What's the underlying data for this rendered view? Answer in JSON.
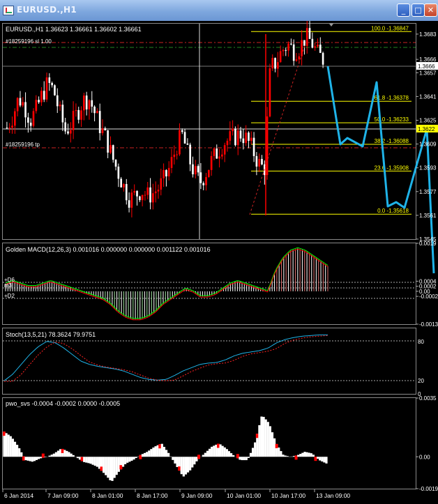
{
  "window": {
    "title": "EURUSD.,H1"
  },
  "colors": {
    "up": "#ff0000",
    "down": "#ffffff",
    "fib": "#ffff00",
    "projection": "#1fb3e8",
    "current_price": "#ffff00",
    "macd_green": "#00ff00",
    "macd_red": "#ff0000"
  },
  "chart_data": [
    {
      "type": "candlestick",
      "title": "EURUSD.,H1 1.36623 1.36661 1.36602 1.36661",
      "order_labels": [
        "#18259196 sl 1.00",
        "#18259196 tp"
      ],
      "current_price": "1.3666",
      "price_marker": "1.3622",
      "fib_levels": [
        {
          "label": "100.0 -1.36847",
          "value": 1.36847
        },
        {
          "label": "61.8 -1.36378",
          "value": 1.36378
        },
        {
          "label": "50.0 -1.36233",
          "value": 1.36233
        },
        {
          "label": "38.2 -1.36088",
          "value": 1.36088
        },
        {
          "label": "23.6 -1.35908",
          "value": 1.35908
        },
        {
          "label": "0.0 -1.35618",
          "value": 1.35618
        }
      ],
      "y_ticks": [
        "1.3683",
        "1.3666",
        "1.3657",
        "1.3641",
        "1.3625",
        "1.3609",
        "1.3593",
        "1.3577",
        "1.3561",
        "1.3545"
      ],
      "ylim": [
        1.3545,
        1.369
      ],
      "close_path": [
        1.362,
        1.3628,
        1.364,
        1.3635,
        1.3625,
        1.3632,
        1.3642,
        1.365,
        1.3645,
        1.363,
        1.3618,
        1.3622,
        1.363,
        1.3638,
        1.364,
        1.363,
        1.362,
        1.3612,
        1.36,
        1.359,
        1.358,
        1.3572,
        1.3575,
        1.3578,
        1.3574,
        1.3576,
        1.358,
        1.3586,
        1.3595,
        1.3608,
        1.3615,
        1.36,
        1.359,
        1.3583,
        1.359,
        1.3598,
        1.3604,
        1.361,
        1.3612,
        1.3614,
        1.3616,
        1.3612,
        1.3605,
        1.3596,
        1.3592,
        1.366,
        1.3664,
        1.3672,
        1.3676,
        1.3672,
        1.3674,
        1.3681,
        1.3678,
        1.367,
        1.3666
      ],
      "projection": [
        1.3666,
        1.362,
        1.3616,
        1.3656,
        1.3616,
        1.3579,
        1.3575,
        1.3622,
        1.3548
      ]
    },
    {
      "type": "histogram",
      "title": "Golden MACD(12,26,3) 0.001016 0.000000 0.000000 0.001122 0.001016",
      "level_labels": [
        "+D6",
        "m3",
        "+D2"
      ],
      "y_ticks": [
        "0.0019",
        "0.0004",
        "0.0002",
        "0.00",
        "-0.0002",
        "-0.0013"
      ],
      "ylim": [
        -0.0013,
        0.0019
      ],
      "values": [
        0.0003,
        0.0004,
        0.0003,
        0.0002,
        0.0002,
        0.0003,
        0.0004,
        0.0003,
        0.0002,
        0.0001,
        0.0,
        -0.0001,
        -0.0002,
        -0.0003,
        -0.0005,
        -0.0008,
        -0.001,
        -0.0011,
        -0.0011,
        -0.001,
        -0.0008,
        -0.0005,
        -0.0003,
        -0.0001,
        0.0001,
        0.0,
        -0.0002,
        -0.0002,
        -0.0001,
        0.0001,
        0.0003,
        0.0004,
        0.0003,
        0.0002,
        0.0001,
        0.0,
        0.0008,
        0.0013,
        0.0016,
        0.0017,
        0.0016,
        0.0014,
        0.0012,
        0.001
      ]
    },
    {
      "type": "line",
      "title": "Stoch(13,5,21) 78.3624 79.9751",
      "y_ticks": [
        "80",
        "20",
        "0"
      ],
      "ylim": [
        0,
        100
      ],
      "values": [
        20,
        30,
        45,
        60,
        72,
        80,
        78,
        70,
        60,
        50,
        45,
        42,
        40,
        38,
        35,
        30,
        25,
        22,
        21,
        22,
        28,
        35,
        40,
        45,
        47,
        48,
        52,
        58,
        62,
        64,
        66,
        70,
        78,
        83,
        86,
        88,
        89,
        90,
        90
      ]
    },
    {
      "type": "histogram",
      "title": "pwo_svs -0.0004 -0.0002 0.0000 -0.0005",
      "y_ticks": [
        "0.0035",
        "0.00",
        "-0.0019"
      ],
      "ylim": [
        -0.0019,
        0.0035
      ],
      "values": [
        0.0015,
        0.0012,
        0.0006,
        -0.0002,
        -0.0003,
        -0.0001,
        0.0,
        0.0002,
        0.0005,
        0.0003,
        0.0,
        -0.0003,
        -0.0004,
        -0.0006,
        -0.001,
        -0.0015,
        -0.0009,
        -0.0004,
        -0.0002,
        0.0001,
        0.0003,
        0.0006,
        0.0008,
        0.0002,
        -0.0005,
        -0.0012,
        -0.0008,
        -0.0002,
        0.0002,
        0.0006,
        0.0008,
        0.0005,
        0.0001,
        -0.0002,
        -0.0002,
        0.0008,
        0.0025,
        0.002,
        0.0008,
        0.0001,
        0.0,
        0.0001,
        0.0003,
        0.0002,
        -0.0002,
        -0.0004
      ]
    }
  ],
  "x_labels": [
    "6 Jan 2014",
    "7 Jan 09:00",
    "8 Jan 01:00",
    "8 Jan 17:00",
    "9 Jan 09:00",
    "10 Jan 01:00",
    "10 Jan 17:00",
    "13 Jan 09:00"
  ]
}
